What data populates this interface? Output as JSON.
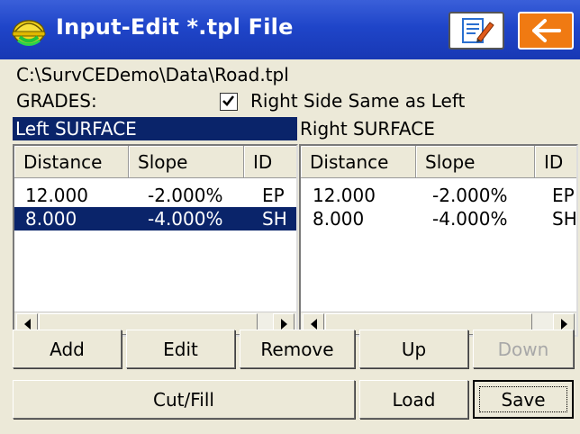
{
  "window": {
    "title": "Input-Edit *.tpl File",
    "icons": {
      "app": "hardhat-surveyor-icon",
      "edit": "edit-notes-icon",
      "back": "arrow-left-icon"
    },
    "colors": {
      "titlebar": "#1f45c9",
      "back_button": "#f07a12",
      "selection": "#0a246a",
      "face": "#ece9d8"
    }
  },
  "file_path": "C:\\SurvCEDemo\\Data\\Road.tpl",
  "grades_label": "GRADES:",
  "right_same_as_left": {
    "checked": true,
    "label": "Right Side Same as Left"
  },
  "left_surface": {
    "header": "Left SURFACE",
    "columns": [
      "Distance",
      "Slope",
      "ID"
    ],
    "rows": [
      {
        "distance": "12.000",
        "slope": "-2.000%",
        "id": "EP",
        "selected": false
      },
      {
        "distance": "8.000",
        "slope": "-4.000%",
        "id": "SH",
        "selected": true
      }
    ]
  },
  "right_surface": {
    "header": "Right SURFACE",
    "columns": [
      "Distance",
      "Slope",
      "ID"
    ],
    "rows": [
      {
        "distance": "12.000",
        "slope": "-2.000%",
        "id": "EP",
        "selected": false
      },
      {
        "distance": "8.000",
        "slope": "-4.000%",
        "id": "SH",
        "selected": false
      }
    ]
  },
  "buttons": {
    "add": "Add",
    "edit": "Edit",
    "remove": "Remove",
    "up": "Up",
    "down": "Down",
    "cut_fill": "Cut/Fill",
    "load": "Load",
    "save": "Save"
  }
}
